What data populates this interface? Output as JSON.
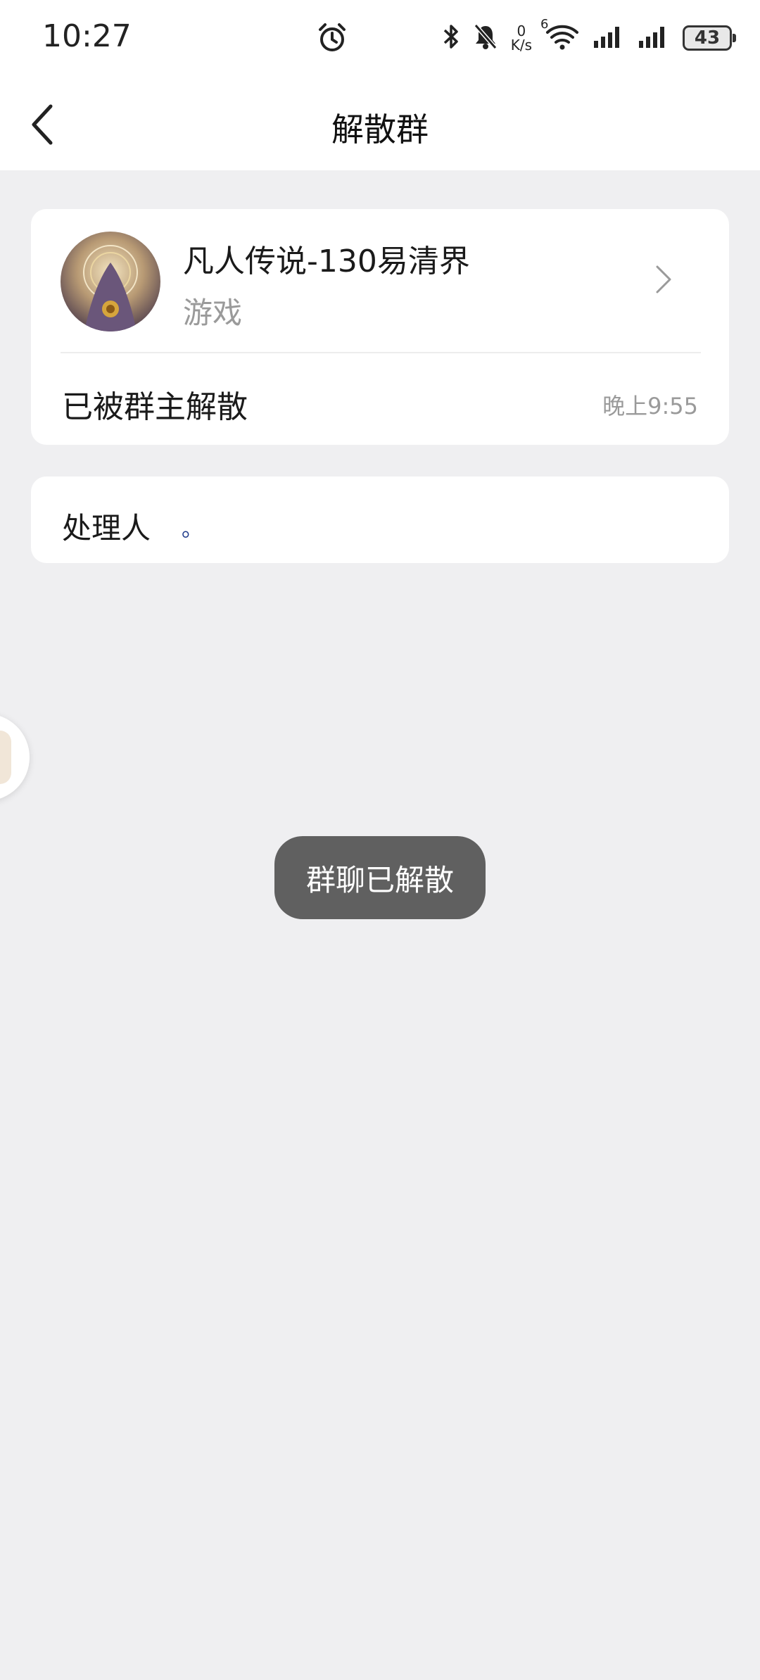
{
  "status_bar": {
    "time": "10:27",
    "net_speed_value": "0",
    "net_speed_unit": "K/s",
    "wifi_badge": "6",
    "battery_level": "43"
  },
  "header": {
    "title": "解散群"
  },
  "group": {
    "name": "凡人传说-130易清界",
    "category": "游戏",
    "status_text": "已被群主解散",
    "status_time": "晚上9:55"
  },
  "handler": {
    "label": "处理人",
    "value": "。"
  },
  "toast": {
    "message": "群聊已解散"
  }
}
